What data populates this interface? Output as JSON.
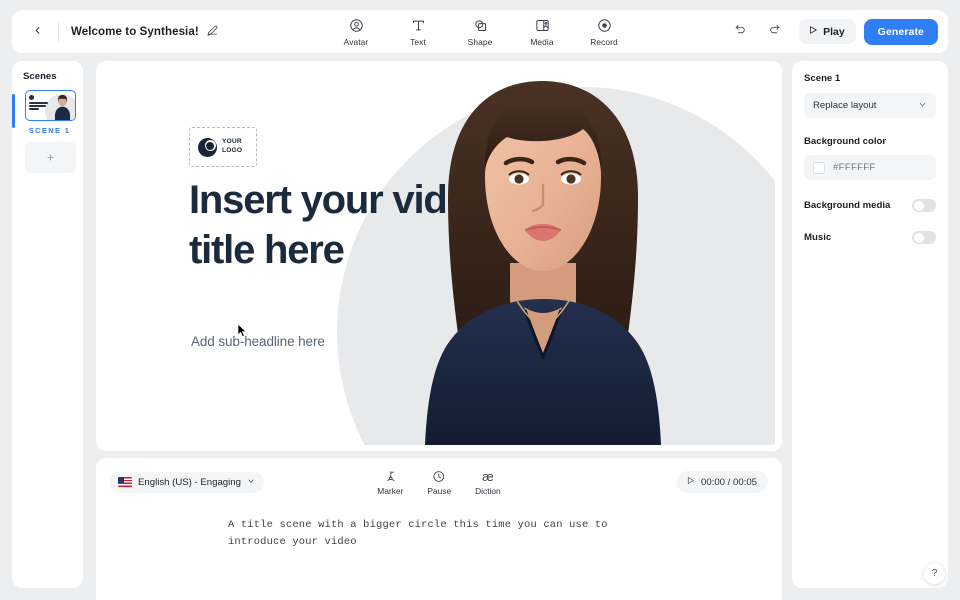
{
  "topbar": {
    "back_icon": "chevron-left-icon",
    "project_title": "Welcome to Synthesia!",
    "edit_icon": "pencil-icon",
    "tools": [
      {
        "label": "Avatar",
        "icon": "avatar-icon"
      },
      {
        "label": "Text",
        "icon": "text-icon"
      },
      {
        "label": "Shape",
        "icon": "shape-icon"
      },
      {
        "label": "Media",
        "icon": "media-icon"
      },
      {
        "label": "Record",
        "icon": "record-icon"
      }
    ],
    "undo_icon": "undo-icon",
    "redo_icon": "redo-icon",
    "play_label": "Play",
    "play_icon": "play-icon",
    "generate_label": "Generate",
    "generate_color": "#2f7ef5"
  },
  "sidebar": {
    "heading": "Scenes",
    "scenes": [
      {
        "label": "SCENE 1",
        "selected": true,
        "accent_color": "#2f7ef5"
      }
    ],
    "add_scene_icon": "plus-icon"
  },
  "canvas": {
    "logo_placeholder": {
      "line1": "YOUR",
      "line2": "LOGO",
      "icon": "logo-mark-icon"
    },
    "title": "Insert your video title here",
    "subheadline": "Add sub-headline here",
    "title_color": "#1b2a3d",
    "background_color": "#FFFFFF",
    "circle_color": "#e8e9eb",
    "avatar_alt": "presenter-avatar"
  },
  "script": {
    "language": "English (US) - Engaging",
    "language_flag": "us-flag-icon",
    "language_chevron": "chevron-down-icon",
    "tools": [
      {
        "label": "Marker",
        "icon": "marker-icon"
      },
      {
        "label": "Pause",
        "icon": "clock-icon"
      },
      {
        "label": "Diction",
        "icon": "diction-icon"
      }
    ],
    "timer": "00:00 / 00:05",
    "timer_icon": "play-icon",
    "text": "A title scene with a bigger circle this time you can use to introduce your video"
  },
  "right_panel": {
    "scene_title": "Scene 1",
    "layout_select": {
      "value": "Replace layout",
      "chevron": "chevron-down-icon"
    },
    "background_color_label": "Background color",
    "background_color_value": "#FFFFFF",
    "toggles": [
      {
        "label": "Background media",
        "on": false
      },
      {
        "label": "Music",
        "on": false
      }
    ]
  },
  "help": {
    "label": "?"
  }
}
